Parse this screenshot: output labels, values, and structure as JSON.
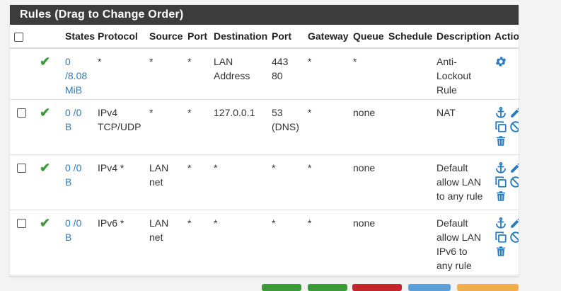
{
  "panel": {
    "title": "Rules (Drag to Change Order)"
  },
  "columns": [
    "States",
    "Protocol",
    "Source",
    "Port",
    "Destination",
    "Port",
    "Gateway",
    "Queue",
    "Schedule",
    "Description",
    "Actions"
  ],
  "rows": [
    {
      "states_line1": "0",
      "states_line2": "/8.08",
      "states_line3": "MiB",
      "protocol_line1": "*",
      "protocol_line2": "",
      "source_line1": "*",
      "source_line2": "",
      "port": "*",
      "destination": "LAN",
      "destination_line2": "Address",
      "dport_line1": "443",
      "dport_line2": "80",
      "gateway": "*",
      "queue": "*",
      "schedule": "",
      "desc_line1": "Anti-",
      "desc_line2": "Lockout",
      "desc_line3": "Rule",
      "desc_line4": ""
    },
    {
      "states_line1": "0 /0",
      "states_line2": "B",
      "states_line3": "",
      "protocol_line1": "IPv4",
      "protocol_line2": "TCP/UDP",
      "source_line1": "*",
      "source_line2": "",
      "port": "*",
      "destination": "127.0.0.1",
      "destination_line2": "",
      "dport_line1": "53",
      "dport_line2": "(DNS)",
      "gateway": "*",
      "queue": "none",
      "schedule": "",
      "desc_line1": "NAT",
      "desc_line2": "",
      "desc_line3": "",
      "desc_line4": ""
    },
    {
      "states_line1": "0 /0",
      "states_line2": "B",
      "states_line3": "",
      "protocol_line1": "IPv4 *",
      "protocol_line2": "",
      "source_line1": "LAN",
      "source_line2": "net",
      "port": "*",
      "destination": "*",
      "destination_line2": "",
      "dport_line1": "*",
      "dport_line2": "",
      "gateway": "*",
      "queue": "none",
      "schedule": "",
      "desc_line1": "Default",
      "desc_line2": "allow LAN",
      "desc_line3": "to any rule",
      "desc_line4": ""
    },
    {
      "states_line1": "0 /0",
      "states_line2": "B",
      "states_line3": "",
      "protocol_line1": "IPv6 *",
      "protocol_line2": "",
      "source_line1": "LAN",
      "source_line2": "net",
      "port": "*",
      "destination": "*",
      "destination_line2": "",
      "dport_line1": "*",
      "dport_line2": "",
      "gateway": "*",
      "queue": "none",
      "schedule": "",
      "desc_line1": "Default",
      "desc_line2": "allow LAN",
      "desc_line3": "IPv6 to",
      "desc_line4": "any rule"
    }
  ],
  "icons": {
    "pass": "check-icon",
    "settings": "gear-icon",
    "anchor": "anchor-icon",
    "edit": "pencil-icon",
    "copy": "copy-icon",
    "disable": "ban-icon",
    "delete": "trash-icon"
  },
  "colors": {
    "header_bg": "#3c3c3c",
    "link": "#337ab7",
    "pass_green": "#3c9b38",
    "action_blue": "#2a7ac0",
    "button_green": "#3c9b38",
    "button_red": "#c0272d",
    "button_blue": "#5ba0d8",
    "button_orange": "#f0ad4e"
  }
}
